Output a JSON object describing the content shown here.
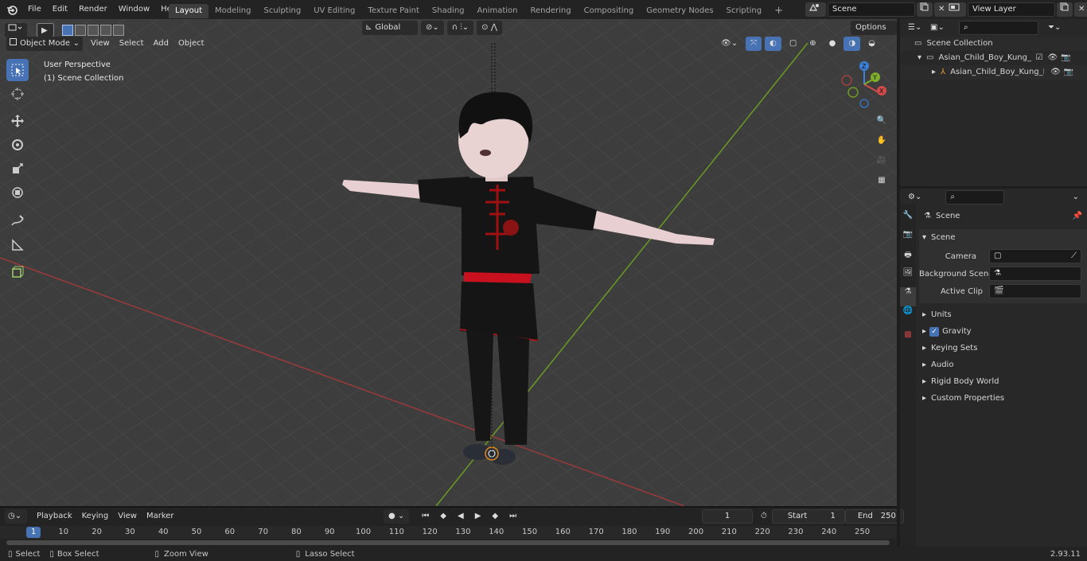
{
  "topbar": {
    "menus": [
      "File",
      "Edit",
      "Render",
      "Window",
      "Help"
    ],
    "workspaces": [
      {
        "label": "Layout",
        "active": true
      },
      {
        "label": "Modeling"
      },
      {
        "label": "Sculpting"
      },
      {
        "label": "UV Editing"
      },
      {
        "label": "Texture Paint"
      },
      {
        "label": "Shading"
      },
      {
        "label": "Animation"
      },
      {
        "label": "Rendering"
      },
      {
        "label": "Compositing"
      },
      {
        "label": "Geometry Nodes"
      },
      {
        "label": "Scripting"
      }
    ],
    "add_workspace": "+",
    "scene_name": "Scene",
    "view_layer": "View Layer"
  },
  "viewport_header": {
    "mode": "Object Mode",
    "view": "View",
    "select": "Select",
    "add": "Add",
    "object": "Object",
    "orientation": "Global",
    "options": "Options"
  },
  "viewport": {
    "perspective_label": "User Perspective",
    "collection_label": "(1) Scene Collection",
    "axes": {
      "x": "X",
      "y": "Y",
      "z": "Z"
    },
    "colors": {
      "background": "#3d3d3d",
      "grid": "#474747",
      "x_axis": "#a03a3a",
      "y_axis": "#6e9c24",
      "active": "#4772b3"
    }
  },
  "outliner": {
    "root": "Scene Collection",
    "items": [
      {
        "label": "Asian_Child_Boy_Kung_Fu_Pc",
        "level": 1
      },
      {
        "label": "Asian_Child_Boy_Kung_F",
        "level": 2
      }
    ]
  },
  "properties": {
    "context": "Scene",
    "panel_title": "Scene",
    "fields": [
      {
        "label": "Camera"
      },
      {
        "label": "Background Scene"
      },
      {
        "label": "Active Clip"
      }
    ],
    "subpanels": [
      "Units",
      "Gravity",
      "Keying Sets",
      "Audio",
      "Rigid Body World",
      "Custom Properties"
    ],
    "gravity_checked": true
  },
  "timeline": {
    "menus": [
      "Playback",
      "Keying",
      "View",
      "Marker"
    ],
    "current_frame": "1",
    "start_label": "Start",
    "start_value": "1",
    "end_label": "End",
    "end_value": "250",
    "ruler": [
      "1",
      "10",
      "20",
      "30",
      "40",
      "50",
      "60",
      "70",
      "80",
      "90",
      "100",
      "110",
      "120",
      "130",
      "140",
      "150",
      "160",
      "170",
      "180",
      "190",
      "200",
      "210",
      "220",
      "230",
      "240",
      "250"
    ]
  },
  "statusbar": {
    "select": "Select",
    "box_select": "Box Select",
    "zoom_view": "Zoom View",
    "lasso_select": "Lasso Select",
    "version": "2.93.11"
  }
}
